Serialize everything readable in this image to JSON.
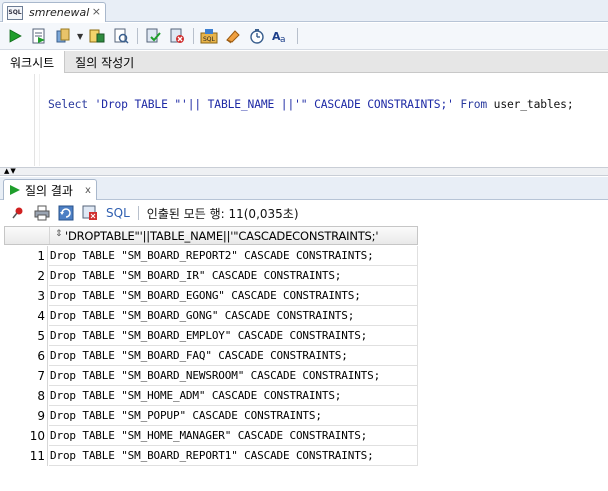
{
  "document_tab": {
    "title": "smrenewal",
    "close": "×"
  },
  "toolbar": {
    "icons": [
      "run-statement-icon",
      "run-script-icon",
      "commit-icon",
      "dropdown-arrow-icon",
      "explain-plan-icon",
      "autotrace-icon",
      "rollback-icon",
      "cancel-icon",
      "sql-tuning-icon",
      "clear-icon",
      "history-icon",
      "format-icon"
    ]
  },
  "subtabs": [
    {
      "label": "워크시트"
    },
    {
      "label": "질의 작성기"
    }
  ],
  "editor": {
    "sql": {
      "kw_select": "Select",
      "s1": " 'Drop TABLE \"'|| TABLE_NAME ||'\" CASCADE CONSTRAINTS;' ",
      "kw_from": "From",
      "table": " user_tables;"
    }
  },
  "splitter": {
    "arrows": "▲▼"
  },
  "result_tab": {
    "label": "질의 결과",
    "close": "x"
  },
  "result_toolbar": {
    "sql_label": "SQL",
    "status": "인출된 모든 행: 11(0,035초)"
  },
  "grid": {
    "column_header": "'DROPTABLE\"'||TABLE_NAME||'\"CASCADECONSTRAINTS;'",
    "sort_icon": "⇕",
    "rows": [
      {
        "num": "1",
        "value": "Drop TABLE \"SM_BOARD_REPORT2\" CASCADE CONSTRAINTS;"
      },
      {
        "num": "2",
        "value": "Drop TABLE \"SM_BOARD_IR\" CASCADE CONSTRAINTS;"
      },
      {
        "num": "3",
        "value": "Drop TABLE \"SM_BOARD_EGONG\" CASCADE CONSTRAINTS;"
      },
      {
        "num": "4",
        "value": "Drop TABLE \"SM_BOARD_GONG\" CASCADE CONSTRAINTS;"
      },
      {
        "num": "5",
        "value": "Drop TABLE \"SM_BOARD_EMPLOY\" CASCADE CONSTRAINTS;"
      },
      {
        "num": "6",
        "value": "Drop TABLE \"SM_BOARD_FAQ\" CASCADE CONSTRAINTS;"
      },
      {
        "num": "7",
        "value": "Drop TABLE \"SM_BOARD_NEWSROOM\" CASCADE CONSTRAINTS;"
      },
      {
        "num": "8",
        "value": "Drop TABLE \"SM_HOME_ADM\" CASCADE CONSTRAINTS;"
      },
      {
        "num": "9",
        "value": "Drop TABLE \"SM_POPUP\" CASCADE CONSTRAINTS;"
      },
      {
        "num": "10",
        "value": "Drop TABLE \"SM_HOME_MANAGER\" CASCADE CONSTRAINTS;"
      },
      {
        "num": "11",
        "value": "Drop TABLE \"SM_BOARD_REPORT1\" CASCADE CONSTRAINTS;"
      }
    ]
  },
  "colors": {
    "accent": "#2f5fb0",
    "run_green": "#1f9e2c",
    "keyword": "#2a3a9e"
  }
}
